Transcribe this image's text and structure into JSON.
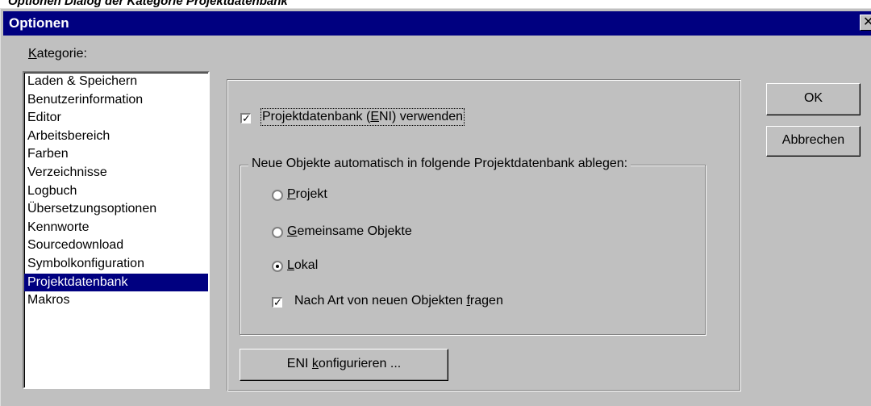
{
  "caption": "Optionen Dialog der Kategorie Projektdatenbank",
  "window": {
    "title": "Optionen",
    "close_glyph": "✕"
  },
  "kategorie": {
    "label_mnemonic": "K",
    "label_rest": "ategorie:",
    "items": [
      "Laden & Speichern",
      "Benutzerinformation",
      "Editor",
      "Arbeitsbereich",
      "Farben",
      "Verzeichnisse",
      "Logbuch",
      "Übersetzungsoptionen",
      "Kennworte",
      "Sourcedownload",
      "Symbolkonfiguration",
      "Projektdatenbank",
      "Makros"
    ],
    "selected_index": 11
  },
  "eni": {
    "checkbox_checked": true,
    "label_before": "Projektdatenbank (",
    "label_mnemonic": "E",
    "label_after": "NI) verwenden"
  },
  "group": {
    "title": "Neue Objekte automatisch in folgende Projektdatenbank ablegen:",
    "options": [
      {
        "mnemonic": "P",
        "rest": "rojekt",
        "selected": false
      },
      {
        "mnemonic": "G",
        "rest": "emeinsame Objekte",
        "selected": false
      },
      {
        "mnemonic": "L",
        "rest": "okal",
        "selected": true
      }
    ],
    "ask_checked": true,
    "ask_before": "Nach Art von neuen Objekten ",
    "ask_mnemonic": "f",
    "ask_after": "ragen"
  },
  "buttons": {
    "ok": "OK",
    "cancel": "Abbrechen",
    "configure_before": "ENI ",
    "configure_mnemonic": "k",
    "configure_after": "onfigurieren ..."
  },
  "icons": {
    "check": "check-icon",
    "radio_dot": "radio-dot-icon",
    "close": "close-icon"
  },
  "colors": {
    "titlebar": "#000080",
    "face": "#c0c0c0",
    "selection": "#000080"
  }
}
